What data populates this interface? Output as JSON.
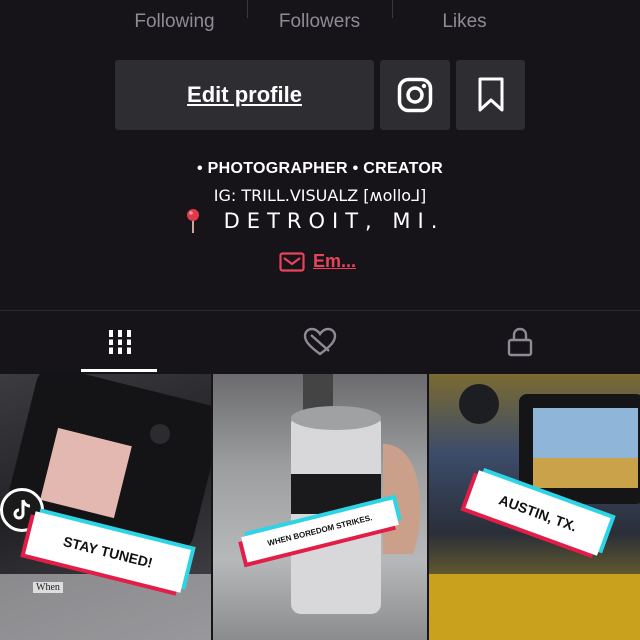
{
  "stats": [
    {
      "label": "Following",
      "value": ""
    },
    {
      "label": "Followers",
      "value": ""
    },
    {
      "label": "Likes",
      "value": ""
    }
  ],
  "actions": {
    "edit_profile": "Edit profile",
    "instagram_icon": "instagram-icon",
    "bookmark_icon": "bookmark-icon"
  },
  "bio": {
    "line1": "• PHOTOGRAPHER • CREATOR",
    "line2": "IG: TRILL.VISUALZ [ʍollo⅃]",
    "line3": "DETROIT, MI."
  },
  "email": {
    "label": "Em..."
  },
  "tabs": [
    {
      "name": "videos-grid-icon",
      "active": true
    },
    {
      "name": "liked-videos-icon",
      "active": false
    },
    {
      "name": "private-videos-icon",
      "active": false
    }
  ],
  "videos": [
    {
      "sticker": "STAY TUNED!",
      "caption_fragment": "When"
    },
    {
      "sticker": "WHEN BOREDOM STRIKES."
    },
    {
      "sticker": "AUSTIN, TX."
    }
  ],
  "colors": {
    "background": "#161419",
    "button": "#2e2d32",
    "accent_red": "#e8435a",
    "muted_text": "#8e8c93"
  }
}
